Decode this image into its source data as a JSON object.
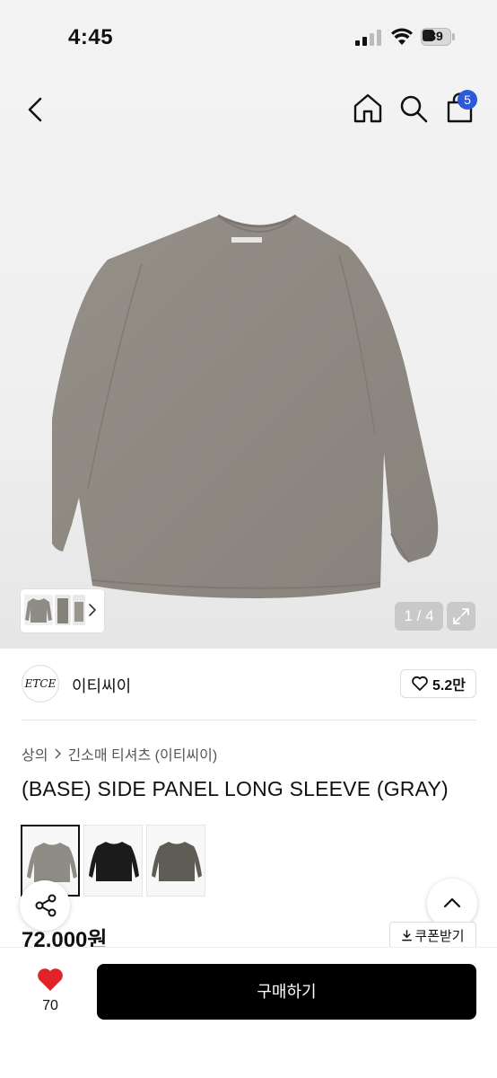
{
  "status_bar": {
    "time": "4:45",
    "battery": "39"
  },
  "header": {
    "cart_count": "5"
  },
  "gallery": {
    "counter": "1 / 4"
  },
  "brand": {
    "logo_text": "ETCE",
    "name": "이티씨이",
    "like_count": "5.2만"
  },
  "breadcrumb": {
    "category": "상의",
    "subcategory": "긴소매 티셔츠 (이티씨이)"
  },
  "product": {
    "title": "(BASE) SIDE PANEL LONG SLEEVE (GRAY)",
    "price": "72,000원",
    "coupon_label": "쿠폰받기",
    "color_options": [
      {
        "color": "#8f8c85",
        "selected": true
      },
      {
        "color": "#1b1b1b",
        "selected": false
      },
      {
        "color": "#5f5c55",
        "selected": false
      }
    ]
  },
  "bottom_bar": {
    "heart_count": "70",
    "buy_label": "구매하기"
  },
  "colors": {
    "shirt": "#8f8c85",
    "badge": "#2b59d9",
    "heart": "#e2222b",
    "buy_bg": "#000000"
  },
  "icons": [
    "back-icon",
    "home-icon",
    "search-icon",
    "bag-icon",
    "chevron-right-icon",
    "expand-icon",
    "heart-outline-icon",
    "share-icon",
    "chevron-up-icon",
    "download-icon",
    "heart-filled-icon"
  ]
}
